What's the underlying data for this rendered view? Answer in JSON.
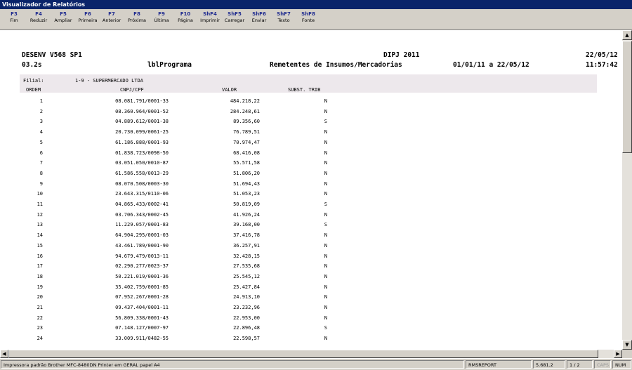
{
  "window": {
    "title": "Visualizador de Relatórios"
  },
  "toolbar": {
    "buttons": [
      {
        "key": "F3",
        "label": "Fim"
      },
      {
        "key": "F4",
        "label": "Reduzir"
      },
      {
        "key": "F5",
        "label": "Ampliar"
      },
      {
        "key": "F6",
        "label": "Primeira"
      },
      {
        "key": "F7",
        "label": "Anterior"
      },
      {
        "key": "F8",
        "label": "Próxima"
      },
      {
        "key": "F9",
        "label": "Última"
      },
      {
        "key": "F10",
        "label": "Página"
      },
      {
        "key": "ShF4",
        "label": "Imprimir"
      },
      {
        "key": "ShF5",
        "label": "Carregar"
      },
      {
        "key": "ShF6",
        "label": "Enviar"
      },
      {
        "key": "ShF7",
        "label": "Texto"
      },
      {
        "key": "ShF8",
        "label": "Fonte"
      }
    ]
  },
  "report": {
    "system": "DESENV V568 SP1",
    "report_title": "DIPJ 2011",
    "date": "22/05/12",
    "version": "03.2s",
    "program": "lblPrograma",
    "subtitle": "Remetentes de Insumos/Mercadorias",
    "period": "01/01/11 a 22/05/12",
    "time": "11:57:42",
    "branch_label": "Filial:",
    "branch_value": "1-9 - SUPERMERCADO LTDA",
    "columns": {
      "order": "ORDEM",
      "cnpj": "CNPJ/CPF",
      "value": "VALOR",
      "subst": "SUBST. TRIB"
    },
    "rows": [
      {
        "order": "1",
        "cnpj": "08.081.791/0001-33",
        "value": "484.218,22",
        "subst": "N"
      },
      {
        "order": "2",
        "cnpj": "08.360.964/0001-52",
        "value": "284.248,61",
        "subst": "N"
      },
      {
        "order": "3",
        "cnpj": "04.889.612/0001-38",
        "value": "89.356,60",
        "subst": "S"
      },
      {
        "order": "4",
        "cnpj": "20.730.099/0061-25",
        "value": "76.789,51",
        "subst": "N"
      },
      {
        "order": "5",
        "cnpj": "61.186.888/0001-93",
        "value": "70.974,47",
        "subst": "N"
      },
      {
        "order": "6",
        "cnpj": "01.838.723/0098-50",
        "value": "68.416,08",
        "subst": "N"
      },
      {
        "order": "7",
        "cnpj": "03.051.050/0010-87",
        "value": "55.571,58",
        "subst": "N"
      },
      {
        "order": "8",
        "cnpj": "61.586.558/0013-29",
        "value": "51.806,20",
        "subst": "N"
      },
      {
        "order": "9",
        "cnpj": "08.070.508/0003-30",
        "value": "51.694,43",
        "subst": "N"
      },
      {
        "order": "10",
        "cnpj": "23.643.315/0110-06",
        "value": "51.053,23",
        "subst": "N"
      },
      {
        "order": "11",
        "cnpj": "04.865.433/0002-41",
        "value": "50.819,09",
        "subst": "S"
      },
      {
        "order": "12",
        "cnpj": "03.706.343/0002-45",
        "value": "41.926,24",
        "subst": "N"
      },
      {
        "order": "13",
        "cnpj": "11.229.057/0001-83",
        "value": "39.168,00",
        "subst": "S"
      },
      {
        "order": "14",
        "cnpj": "64.904.295/0001-03",
        "value": "37.416,78",
        "subst": "N"
      },
      {
        "order": "15",
        "cnpj": "43.461.789/0001-90",
        "value": "36.257,91",
        "subst": "N"
      },
      {
        "order": "16",
        "cnpj": "94.679.479/0013-11",
        "value": "32.428,15",
        "subst": "N"
      },
      {
        "order": "17",
        "cnpj": "02.290.277/0023-37",
        "value": "27.535,68",
        "subst": "N"
      },
      {
        "order": "18",
        "cnpj": "50.221.019/0001-36",
        "value": "25.545,12",
        "subst": "N"
      },
      {
        "order": "19",
        "cnpj": "35.402.759/0001-85",
        "value": "25.427,84",
        "subst": "N"
      },
      {
        "order": "20",
        "cnpj": "07.952.267/0001-28",
        "value": "24.913,10",
        "subst": "N"
      },
      {
        "order": "21",
        "cnpj": "09.437.404/0001-11",
        "value": "23.232,96",
        "subst": "N"
      },
      {
        "order": "22",
        "cnpj": "56.809.338/0001-43",
        "value": "22.953,00",
        "subst": "N"
      },
      {
        "order": "23",
        "cnpj": "07.148.127/0007-97",
        "value": "22.896,48",
        "subst": "S"
      },
      {
        "order": "24",
        "cnpj": "33.009.911/0482-55",
        "value": "22.598,57",
        "subst": "N"
      }
    ]
  },
  "statusbar": {
    "printer": "Impressora padrão Brother MFC-8480DN Printer em GERAL  papel A4",
    "app": "RMSREPORT",
    "zoom": "5.681.2",
    "page": "1 / 2",
    "caps": "CAPS",
    "num": "NUM"
  }
}
